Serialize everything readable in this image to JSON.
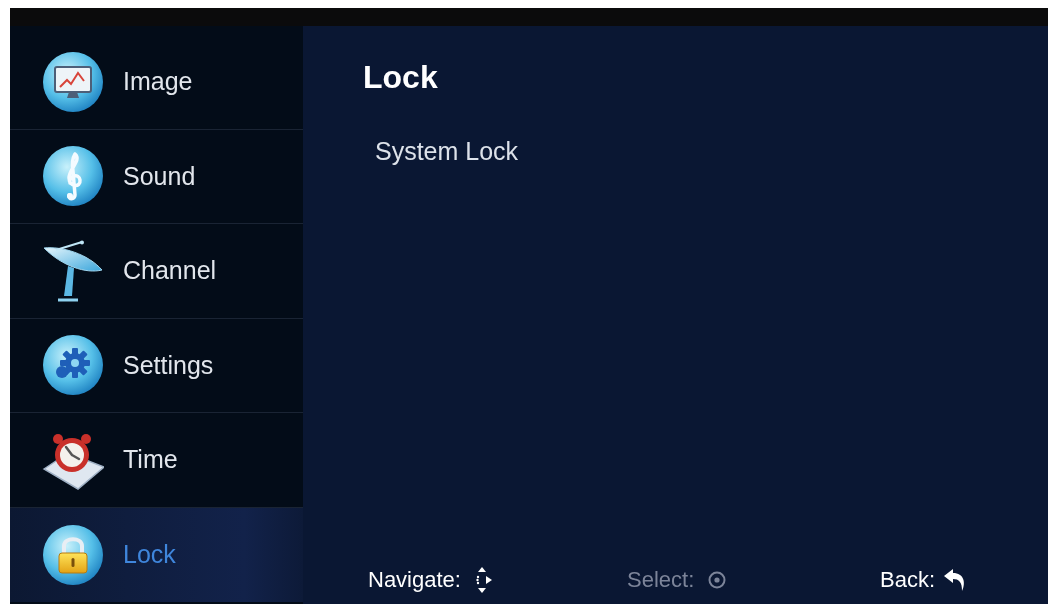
{
  "sidebar": {
    "items": [
      {
        "label": "Image",
        "selected": false
      },
      {
        "label": "Sound",
        "selected": false
      },
      {
        "label": "Channel",
        "selected": false
      },
      {
        "label": "Settings",
        "selected": false
      },
      {
        "label": "Time",
        "selected": false
      },
      {
        "label": "Lock",
        "selected": true
      }
    ]
  },
  "panel": {
    "title": "Lock",
    "items": [
      {
        "label": "System Lock"
      }
    ]
  },
  "footer": {
    "hints": [
      {
        "label": "Navigate:",
        "disabled": false
      },
      {
        "label": "Select:",
        "disabled": true
      },
      {
        "label": "Back:",
        "disabled": false
      }
    ]
  }
}
